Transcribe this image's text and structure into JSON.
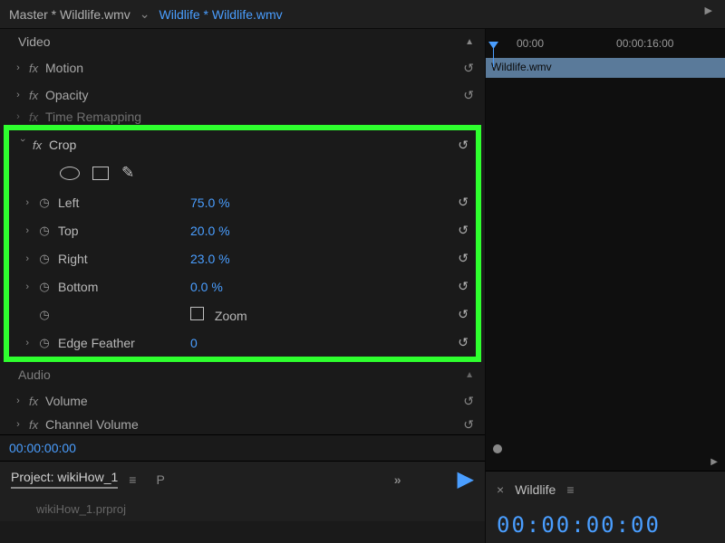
{
  "header": {
    "master_label": "Master * Wildlife.wmv",
    "active_label": "Wildlife * Wildlife.wmv"
  },
  "effects_panel": {
    "section_title": "Video",
    "motion": {
      "label": "Motion"
    },
    "opacity": {
      "label": "Opacity"
    },
    "time_remapping": {
      "label": "Time Remapping"
    },
    "crop": {
      "label": "Crop",
      "left": {
        "label": "Left",
        "value": "75.0 %"
      },
      "top": {
        "label": "Top",
        "value": "20.0 %"
      },
      "right": {
        "label": "Right",
        "value": "23.0 %"
      },
      "bottom": {
        "label": "Bottom",
        "value": "0.0 %"
      },
      "zoom": {
        "label": "Zoom"
      },
      "edge_feather": {
        "label": "Edge Feather",
        "value": "0"
      }
    },
    "audio_title": "Audio",
    "volume": {
      "label": "Volume"
    },
    "channel_volume": {
      "label": "Channel Volume"
    },
    "timecode": "00:00:00:00"
  },
  "project_panel": {
    "tab_label": "Project: wikiHow_1",
    "p_label": "P",
    "footer_item": "wikiHow_1.prproj"
  },
  "timeline": {
    "tick_start": "00:00",
    "tick_end": "00:00:16:00",
    "clip_name": "Wildlife.wmv",
    "sequence_name": "Wildlife",
    "timecode": "00:00:00:00"
  }
}
